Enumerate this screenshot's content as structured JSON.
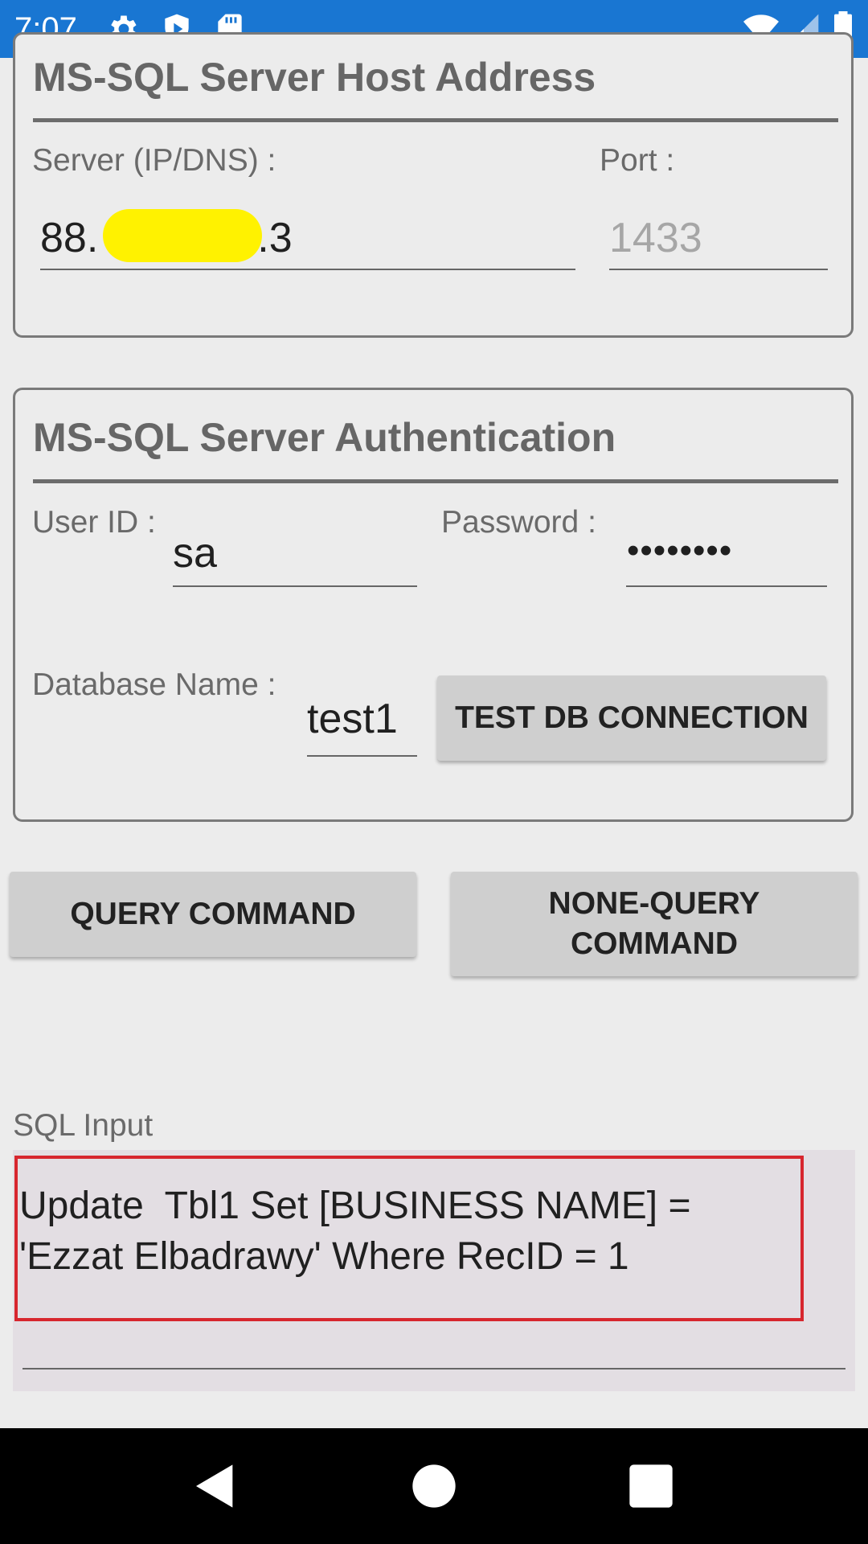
{
  "status_bar": {
    "time": "7:07",
    "left_icons": [
      "settings-icon",
      "shield-icon",
      "sd-card-icon"
    ],
    "right_icons": [
      "wifi-icon",
      "cellular-signal-icon",
      "battery-icon"
    ],
    "background_color": "#1976d2"
  },
  "host_section": {
    "title": "MS-SQL Server Host Address",
    "server_label": "Server (IP/DNS) :",
    "server_value_prefix": "88.",
    "server_value_suffix": ".3",
    "server_value_redacted": true,
    "port_label": "Port :",
    "port_placeholder": "1433"
  },
  "auth_section": {
    "title": "MS-SQL Server Authentication",
    "user_label": "User ID :",
    "user_value": "sa",
    "password_label": "Password :",
    "password_value": "••••••••",
    "database_label": "Database Name :",
    "database_value": "test1",
    "test_button_label": "TEST DB CONNECTION"
  },
  "actions": {
    "query_button_label": "QUERY COMMAND",
    "nonquery_button_label_line1": "NONE-QUERY",
    "nonquery_button_label_line2": "COMMAND"
  },
  "sql_input": {
    "label": "SQL Input",
    "value": "Update  Tbl1 Set [BUSINESS NAME] = 'Ezzat Elbadrawy' Where RecID = 1",
    "highlight_color": "#d7262e"
  },
  "nav_bar": {
    "icons": [
      "back-icon",
      "home-icon",
      "recents-icon"
    ]
  }
}
